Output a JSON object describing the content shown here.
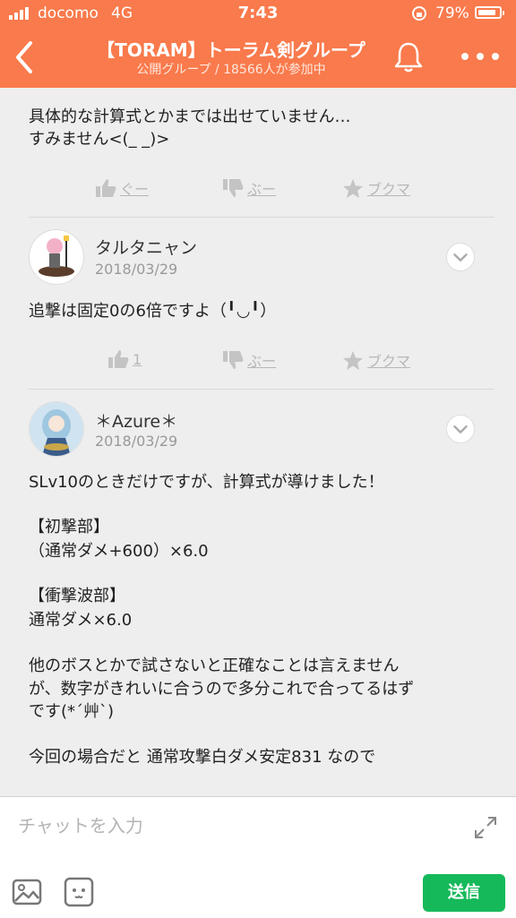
{
  "status_bar": {
    "carrier": "docomo",
    "network": "4G",
    "time": "7:43",
    "battery": "79%"
  },
  "header": {
    "title": "【TORAM】トーラム剣グループ",
    "subtitle": "公開グループ / 18566人が参加中",
    "accent_color": "#f97a4c"
  },
  "post0": {
    "lines": [
      "具体的な計算式とかまでは出せていません…",
      "すみません<(_ _)>"
    ],
    "like": "ぐー",
    "dislike": "ぶー",
    "bookmark": "ブクマ"
  },
  "post1": {
    "name": "タルタニャン",
    "date": "2018/03/29",
    "lines": [
      "追撃は固定0の6倍ですよ（╹◡╹）"
    ],
    "like": "1",
    "dislike": "ぶー",
    "bookmark": "ブクマ"
  },
  "post2": {
    "name": "＊Azure＊",
    "date": "2018/03/29",
    "lines": [
      "SLv10のときだけですが、計算式が導けました！",
      "【初撃部】",
      "（通常ダメ+600）×6.0",
      "【衝撃波部】",
      "通常ダメ×6.0",
      "他のボスとかで試さないと正確なことは言えません",
      "が、数字がきれいに合うので多分これで合ってるはず",
      "です(*ˊ艸ˋ)",
      "今回の場合だと 通常攻撃白ダメ安定831 なので"
    ]
  },
  "input": {
    "placeholder": "チャットを入力",
    "send_label": "送信",
    "send_color": "#16b95a"
  }
}
